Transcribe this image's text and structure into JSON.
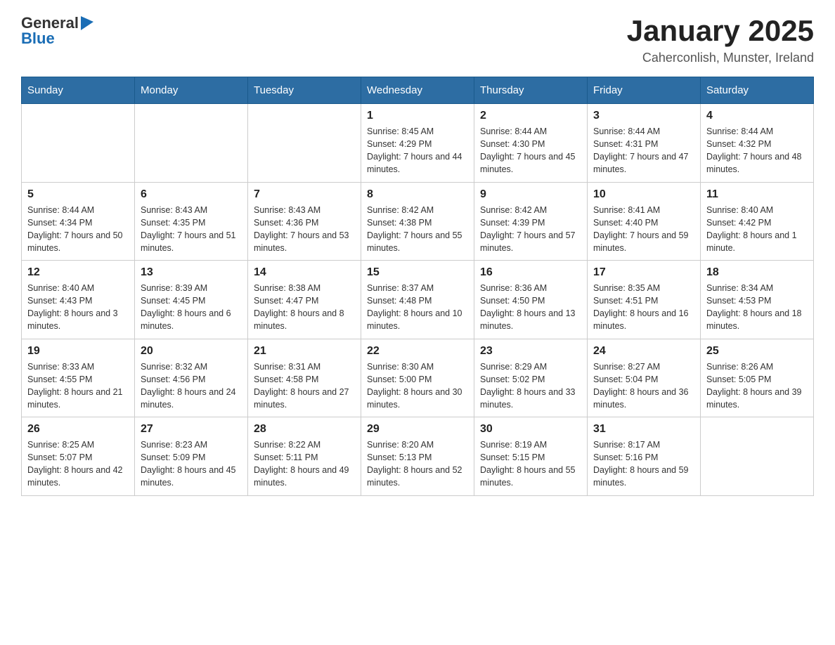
{
  "header": {
    "logo": {
      "general": "General",
      "blue": "Blue"
    },
    "title": "January 2025",
    "location": "Caherconlish, Munster, Ireland"
  },
  "weekdays": [
    "Sunday",
    "Monday",
    "Tuesday",
    "Wednesday",
    "Thursday",
    "Friday",
    "Saturday"
  ],
  "weeks": [
    [
      {
        "day": "",
        "info": ""
      },
      {
        "day": "",
        "info": ""
      },
      {
        "day": "",
        "info": ""
      },
      {
        "day": "1",
        "info": "Sunrise: 8:45 AM\nSunset: 4:29 PM\nDaylight: 7 hours and 44 minutes."
      },
      {
        "day": "2",
        "info": "Sunrise: 8:44 AM\nSunset: 4:30 PM\nDaylight: 7 hours and 45 minutes."
      },
      {
        "day": "3",
        "info": "Sunrise: 8:44 AM\nSunset: 4:31 PM\nDaylight: 7 hours and 47 minutes."
      },
      {
        "day": "4",
        "info": "Sunrise: 8:44 AM\nSunset: 4:32 PM\nDaylight: 7 hours and 48 minutes."
      }
    ],
    [
      {
        "day": "5",
        "info": "Sunrise: 8:44 AM\nSunset: 4:34 PM\nDaylight: 7 hours and 50 minutes."
      },
      {
        "day": "6",
        "info": "Sunrise: 8:43 AM\nSunset: 4:35 PM\nDaylight: 7 hours and 51 minutes."
      },
      {
        "day": "7",
        "info": "Sunrise: 8:43 AM\nSunset: 4:36 PM\nDaylight: 7 hours and 53 minutes."
      },
      {
        "day": "8",
        "info": "Sunrise: 8:42 AM\nSunset: 4:38 PM\nDaylight: 7 hours and 55 minutes."
      },
      {
        "day": "9",
        "info": "Sunrise: 8:42 AM\nSunset: 4:39 PM\nDaylight: 7 hours and 57 minutes."
      },
      {
        "day": "10",
        "info": "Sunrise: 8:41 AM\nSunset: 4:40 PM\nDaylight: 7 hours and 59 minutes."
      },
      {
        "day": "11",
        "info": "Sunrise: 8:40 AM\nSunset: 4:42 PM\nDaylight: 8 hours and 1 minute."
      }
    ],
    [
      {
        "day": "12",
        "info": "Sunrise: 8:40 AM\nSunset: 4:43 PM\nDaylight: 8 hours and 3 minutes."
      },
      {
        "day": "13",
        "info": "Sunrise: 8:39 AM\nSunset: 4:45 PM\nDaylight: 8 hours and 6 minutes."
      },
      {
        "day": "14",
        "info": "Sunrise: 8:38 AM\nSunset: 4:47 PM\nDaylight: 8 hours and 8 minutes."
      },
      {
        "day": "15",
        "info": "Sunrise: 8:37 AM\nSunset: 4:48 PM\nDaylight: 8 hours and 10 minutes."
      },
      {
        "day": "16",
        "info": "Sunrise: 8:36 AM\nSunset: 4:50 PM\nDaylight: 8 hours and 13 minutes."
      },
      {
        "day": "17",
        "info": "Sunrise: 8:35 AM\nSunset: 4:51 PM\nDaylight: 8 hours and 16 minutes."
      },
      {
        "day": "18",
        "info": "Sunrise: 8:34 AM\nSunset: 4:53 PM\nDaylight: 8 hours and 18 minutes."
      }
    ],
    [
      {
        "day": "19",
        "info": "Sunrise: 8:33 AM\nSunset: 4:55 PM\nDaylight: 8 hours and 21 minutes."
      },
      {
        "day": "20",
        "info": "Sunrise: 8:32 AM\nSunset: 4:56 PM\nDaylight: 8 hours and 24 minutes."
      },
      {
        "day": "21",
        "info": "Sunrise: 8:31 AM\nSunset: 4:58 PM\nDaylight: 8 hours and 27 minutes."
      },
      {
        "day": "22",
        "info": "Sunrise: 8:30 AM\nSunset: 5:00 PM\nDaylight: 8 hours and 30 minutes."
      },
      {
        "day": "23",
        "info": "Sunrise: 8:29 AM\nSunset: 5:02 PM\nDaylight: 8 hours and 33 minutes."
      },
      {
        "day": "24",
        "info": "Sunrise: 8:27 AM\nSunset: 5:04 PM\nDaylight: 8 hours and 36 minutes."
      },
      {
        "day": "25",
        "info": "Sunrise: 8:26 AM\nSunset: 5:05 PM\nDaylight: 8 hours and 39 minutes."
      }
    ],
    [
      {
        "day": "26",
        "info": "Sunrise: 8:25 AM\nSunset: 5:07 PM\nDaylight: 8 hours and 42 minutes."
      },
      {
        "day": "27",
        "info": "Sunrise: 8:23 AM\nSunset: 5:09 PM\nDaylight: 8 hours and 45 minutes."
      },
      {
        "day": "28",
        "info": "Sunrise: 8:22 AM\nSunset: 5:11 PM\nDaylight: 8 hours and 49 minutes."
      },
      {
        "day": "29",
        "info": "Sunrise: 8:20 AM\nSunset: 5:13 PM\nDaylight: 8 hours and 52 minutes."
      },
      {
        "day": "30",
        "info": "Sunrise: 8:19 AM\nSunset: 5:15 PM\nDaylight: 8 hours and 55 minutes."
      },
      {
        "day": "31",
        "info": "Sunrise: 8:17 AM\nSunset: 5:16 PM\nDaylight: 8 hours and 59 minutes."
      },
      {
        "day": "",
        "info": ""
      }
    ]
  ]
}
